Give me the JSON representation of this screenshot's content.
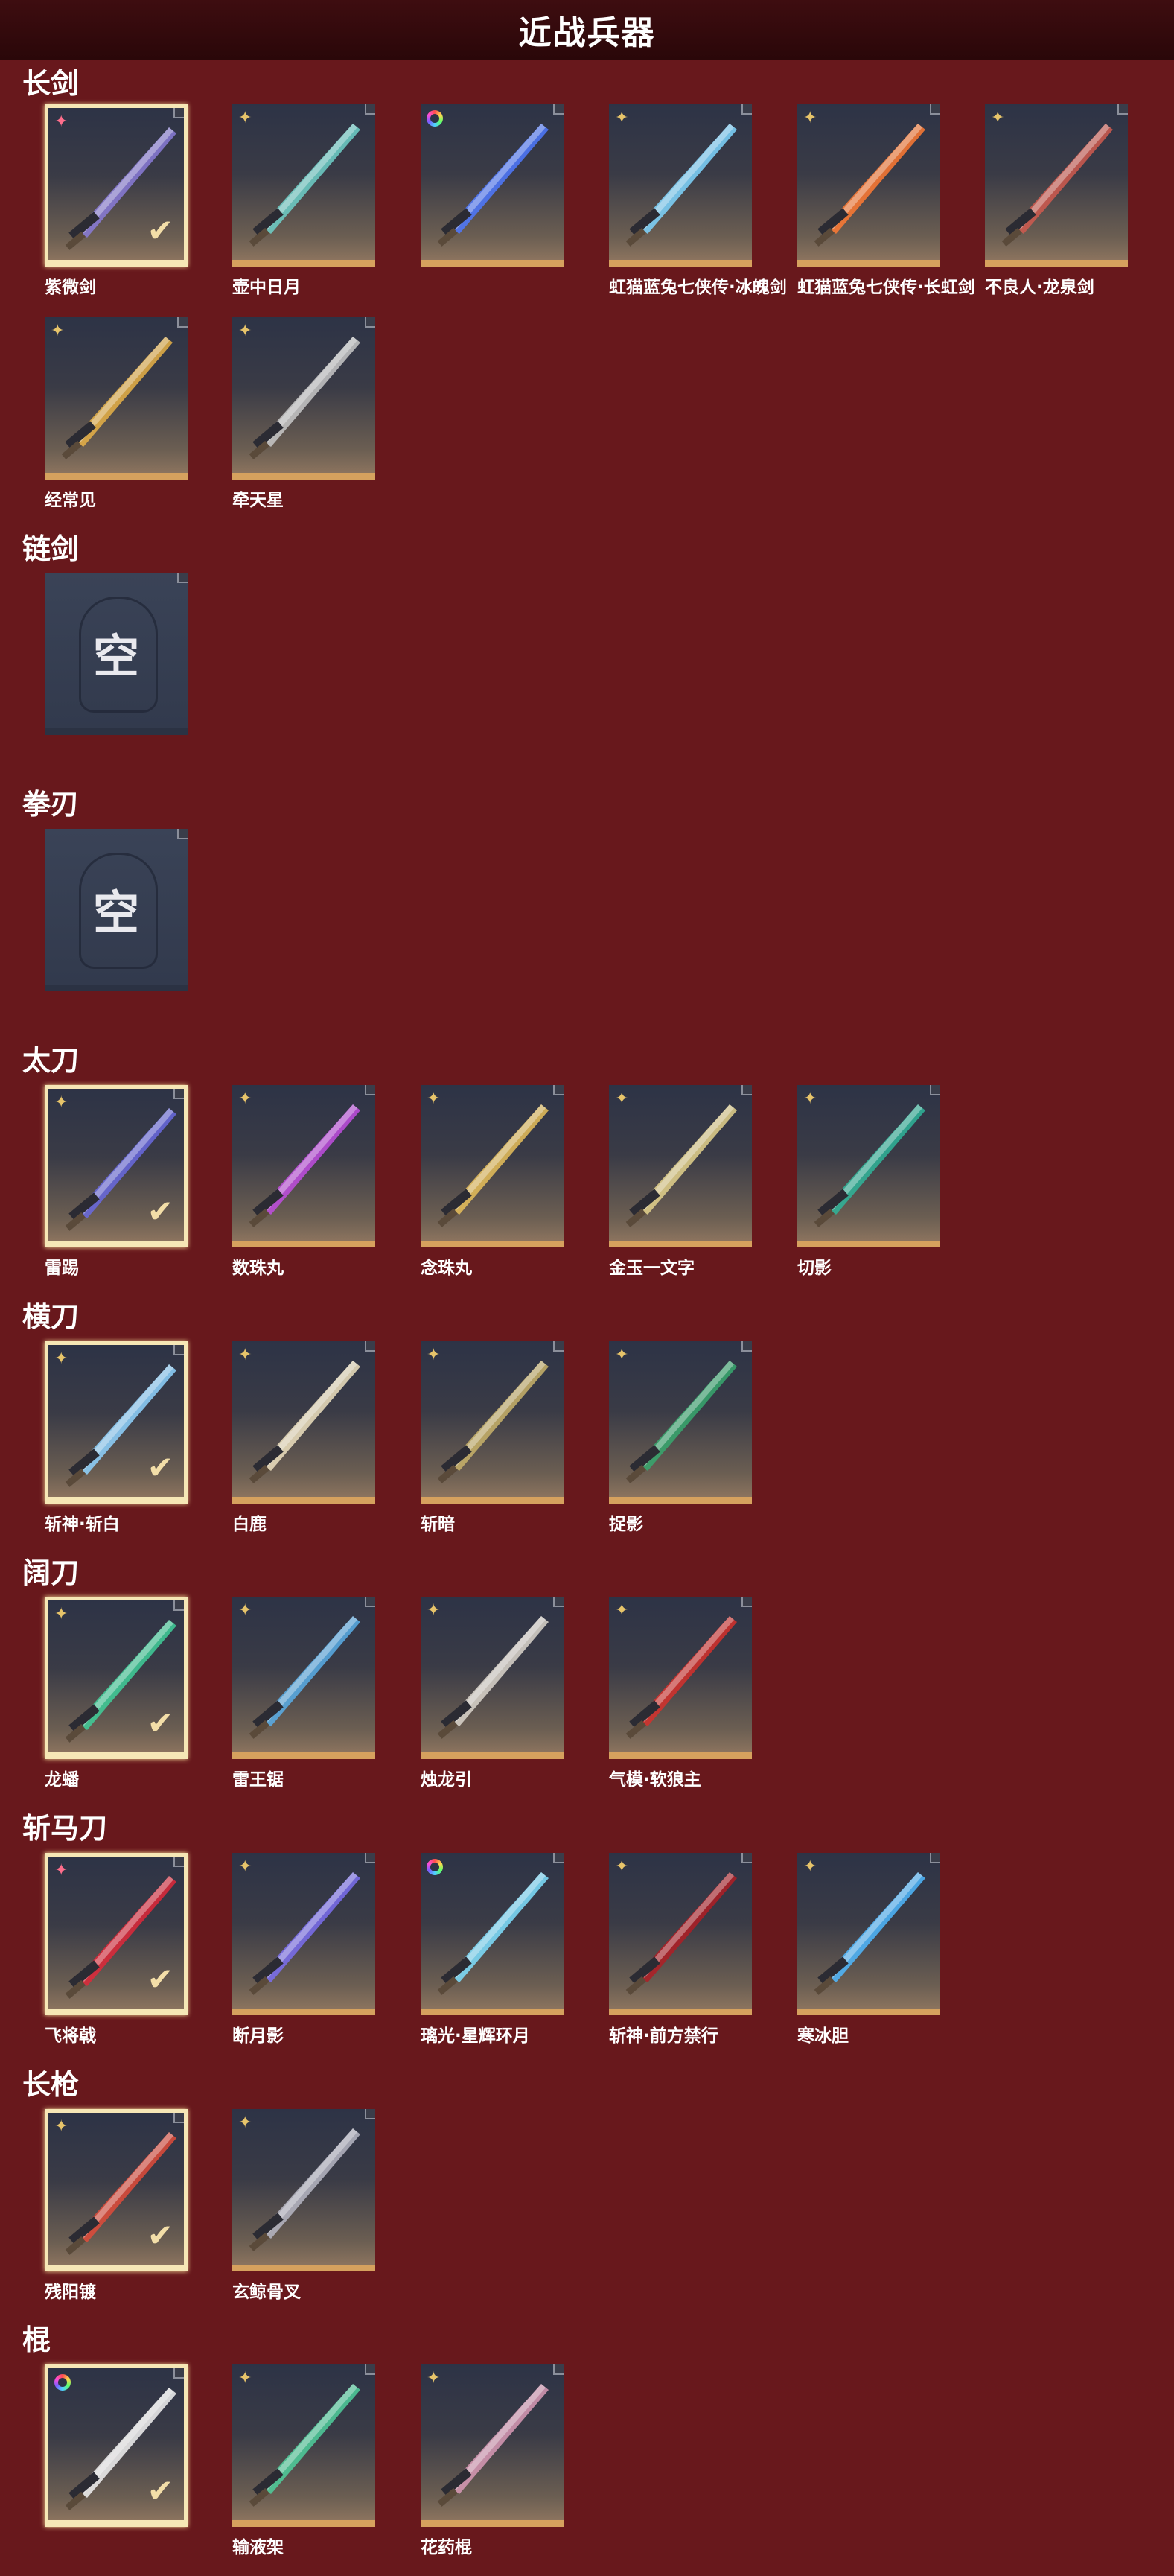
{
  "page_title": "近战兵器",
  "categories": [
    {
      "title": "长剑",
      "items": [
        {
          "name": "紫微剑",
          "rarity": "pink",
          "selected": true,
          "color": "#8a7bd8"
        },
        {
          "name": "壶中日月",
          "rarity": "gold",
          "selected": false,
          "color": "#6fd0c9"
        },
        {
          "name": "",
          "rarity": "rainbow",
          "selected": false,
          "color": "#4f79ff"
        },
        {
          "name": "虹猫蓝兔七侠传·冰魄剑",
          "rarity": "gold",
          "selected": false,
          "color": "#7fd6ff"
        },
        {
          "name": "虹猫蓝兔七侠传·长虹剑",
          "rarity": "gold",
          "selected": false,
          "color": "#ff7a32"
        },
        {
          "name": "不良人·龙泉剑",
          "rarity": "gold",
          "selected": false,
          "color": "#d05a4f"
        },
        {
          "name": "经常见",
          "rarity": "gold",
          "selected": false,
          "color": "#e7b247"
        },
        {
          "name": "牵天星",
          "rarity": "gold",
          "selected": false,
          "color": "#c8c8c8"
        }
      ]
    },
    {
      "title": "链剑",
      "empty": true,
      "empty_label": "空"
    },
    {
      "title": "拳刃",
      "empty": true,
      "empty_label": "空"
    },
    {
      "title": "太刀",
      "items": [
        {
          "name": "雷踢",
          "rarity": "gold",
          "selected": true,
          "color": "#6a6ae0"
        },
        {
          "name": "数珠丸",
          "rarity": "gold",
          "selected": false,
          "color": "#c14de0"
        },
        {
          "name": "念珠丸",
          "rarity": "gold",
          "selected": false,
          "color": "#e7c05a"
        },
        {
          "name": "金玉一文字",
          "rarity": "gold",
          "selected": false,
          "color": "#e4d28c"
        },
        {
          "name": "切影",
          "rarity": "gold",
          "selected": false,
          "color": "#2fb59a"
        }
      ]
    },
    {
      "title": "横刀",
      "items": [
        {
          "name": "斩神·斩白",
          "rarity": "gold",
          "selected": true,
          "color": "#8fd3ff"
        },
        {
          "name": "白鹿",
          "rarity": "gold",
          "selected": false,
          "color": "#efe2c0"
        },
        {
          "name": "斩暗",
          "rarity": "gold",
          "selected": false,
          "color": "#c9b36a"
        },
        {
          "name": "捉影",
          "rarity": "gold",
          "selected": false,
          "color": "#37a86f"
        }
      ]
    },
    {
      "title": "阔刀",
      "items": [
        {
          "name": "龙蟠",
          "rarity": "gold",
          "selected": true,
          "color": "#3fcf9a"
        },
        {
          "name": "雷王锯",
          "rarity": "gold",
          "selected": false,
          "color": "#59aee8"
        },
        {
          "name": "烛龙引",
          "rarity": "gold",
          "selected": false,
          "color": "#dcd6cc"
        },
        {
          "name": "气模·软狼主",
          "rarity": "gold",
          "selected": false,
          "color": "#d6302b"
        }
      ]
    },
    {
      "title": "斩马刀",
      "items": [
        {
          "name": "飞将戟",
          "rarity": "pink",
          "selected": true,
          "color": "#e0283a"
        },
        {
          "name": "断月影",
          "rarity": "gold",
          "selected": false,
          "color": "#7b6ff0"
        },
        {
          "name": "璃光·星辉环月",
          "rarity": "rainbow",
          "selected": false,
          "color": "#7fe0ff"
        },
        {
          "name": "斩神·前方禁行",
          "rarity": "gold",
          "selected": false,
          "color": "#b01d24"
        },
        {
          "name": "寒冰胆",
          "rarity": "gold",
          "selected": false,
          "color": "#4fb8ff"
        }
      ]
    },
    {
      "title": "长枪",
      "items": [
        {
          "name": "残阳镀",
          "rarity": "gold",
          "selected": true,
          "color": "#e04b3a"
        },
        {
          "name": "玄鲸骨叉",
          "rarity": "gold",
          "selected": false,
          "color": "#b7b7c4"
        }
      ]
    },
    {
      "title": "棍",
      "items": [
        {
          "name": "",
          "rarity": "rainbow",
          "selected": true,
          "color": "#f2f2f2"
        },
        {
          "name": "输液架",
          "rarity": "gold",
          "selected": false,
          "color": "#4fcf9c"
        },
        {
          "name": "花药棍",
          "rarity": "gold",
          "selected": false,
          "color": "#d99ab6"
        }
      ]
    }
  ]
}
